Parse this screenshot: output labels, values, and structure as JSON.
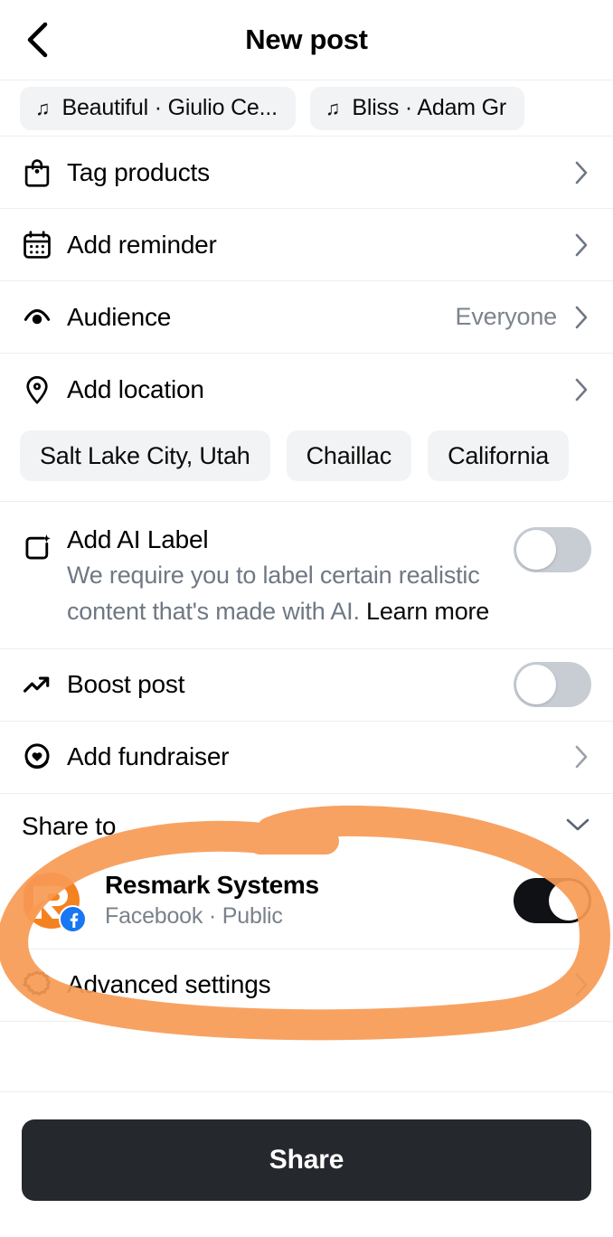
{
  "header": {
    "back_icon": "chevron-left-icon",
    "title": "New post"
  },
  "music": {
    "note_icon": "music-note-icon",
    "chips": [
      {
        "label": "Beautiful · Giulio Ce..."
      },
      {
        "label": "Bliss · Adam Gr"
      }
    ]
  },
  "rows": {
    "tag_products": {
      "label": "Tag products",
      "icon": "shopping-bag-icon",
      "chevron": "chevron-right-icon"
    },
    "add_reminder": {
      "label": "Add reminder",
      "icon": "calendar-icon",
      "chevron": "chevron-right-icon"
    },
    "audience": {
      "label": "Audience",
      "value": "Everyone",
      "icon": "eye-icon",
      "chevron": "chevron-right-icon"
    },
    "add_location": {
      "label": "Add location",
      "icon": "location-pin-icon",
      "chevron": "chevron-right-icon"
    },
    "boost_post": {
      "label": "Boost post",
      "icon": "trending-up-icon",
      "toggle": "off"
    },
    "add_fundraiser": {
      "label": "Add fundraiser",
      "icon": "heart-circle-icon",
      "chevron": "chevron-right-icon"
    },
    "advanced_settings": {
      "label": "Advanced settings",
      "icon": "gear-icon",
      "chevron": "chevron-right-icon"
    }
  },
  "location_suggestions": [
    {
      "label": "Salt Lake City, Utah"
    },
    {
      "label": "Chaillac"
    },
    {
      "label": "California"
    }
  ],
  "ai_label": {
    "icon": "ai-sparkle-square-icon",
    "title": "Add AI Label",
    "description": "We require you to label certain realistic content that's made with AI. ",
    "learn_more": "Learn more",
    "toggle": "off"
  },
  "share_to": {
    "title": "Share to",
    "chevron": "chevron-down-icon",
    "account": {
      "avatar": "resmark-logo-avatar",
      "badge_icon": "facebook-badge-icon",
      "name": "Resmark Systems",
      "subtitle": "Facebook · Public",
      "toggle": "on"
    }
  },
  "footer": {
    "share_button": "Share"
  },
  "colors": {
    "accent_dark": "#25282d",
    "toggle_off": "#c8cdd4",
    "toggle_on": "#0f1115",
    "chip_bg": "#f2f3f5",
    "muted_text": "#79818b",
    "facebook_blue": "#1877f2",
    "annotation_orange": "#F79A55",
    "logo_orange": "#F58220"
  }
}
